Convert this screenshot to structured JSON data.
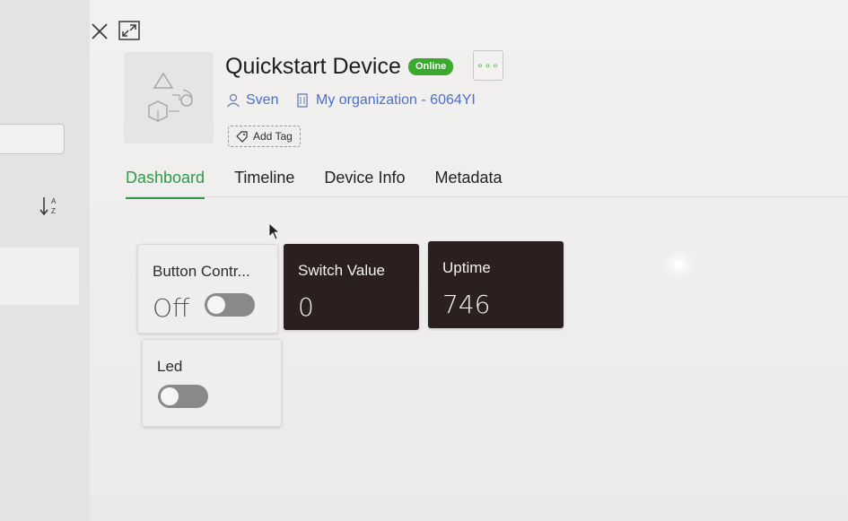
{
  "device": {
    "title": "Quickstart Device",
    "status": "Online",
    "owner": "Sven",
    "organization": "My organization - 6064YI",
    "add_tag_label": "Add Tag"
  },
  "tabs": [
    {
      "label": "Dashboard",
      "active": true
    },
    {
      "label": "Timeline",
      "active": false
    },
    {
      "label": "Device Info",
      "active": false
    },
    {
      "label": "Metadata",
      "active": false
    }
  ],
  "widgets": {
    "button_control": {
      "title": "Button Contr...",
      "value": "Off",
      "toggle_on": false
    },
    "switch_value": {
      "title": "Switch Value",
      "value": "0"
    },
    "uptime": {
      "title": "Uptime",
      "value": "746"
    },
    "led": {
      "title": "Led",
      "toggle_on": false
    }
  },
  "colors": {
    "accent": "#2e9a4a",
    "online_badge": "#3ba82e",
    "link": "#4a6fd0",
    "dark_widget": "#2b1f20"
  },
  "icons": {
    "close": "close-icon",
    "expand": "expand-icon",
    "more": "more-icon",
    "user": "user-icon",
    "organization": "building-icon",
    "tag": "tag-icon",
    "sort": "sort-az-icon"
  }
}
